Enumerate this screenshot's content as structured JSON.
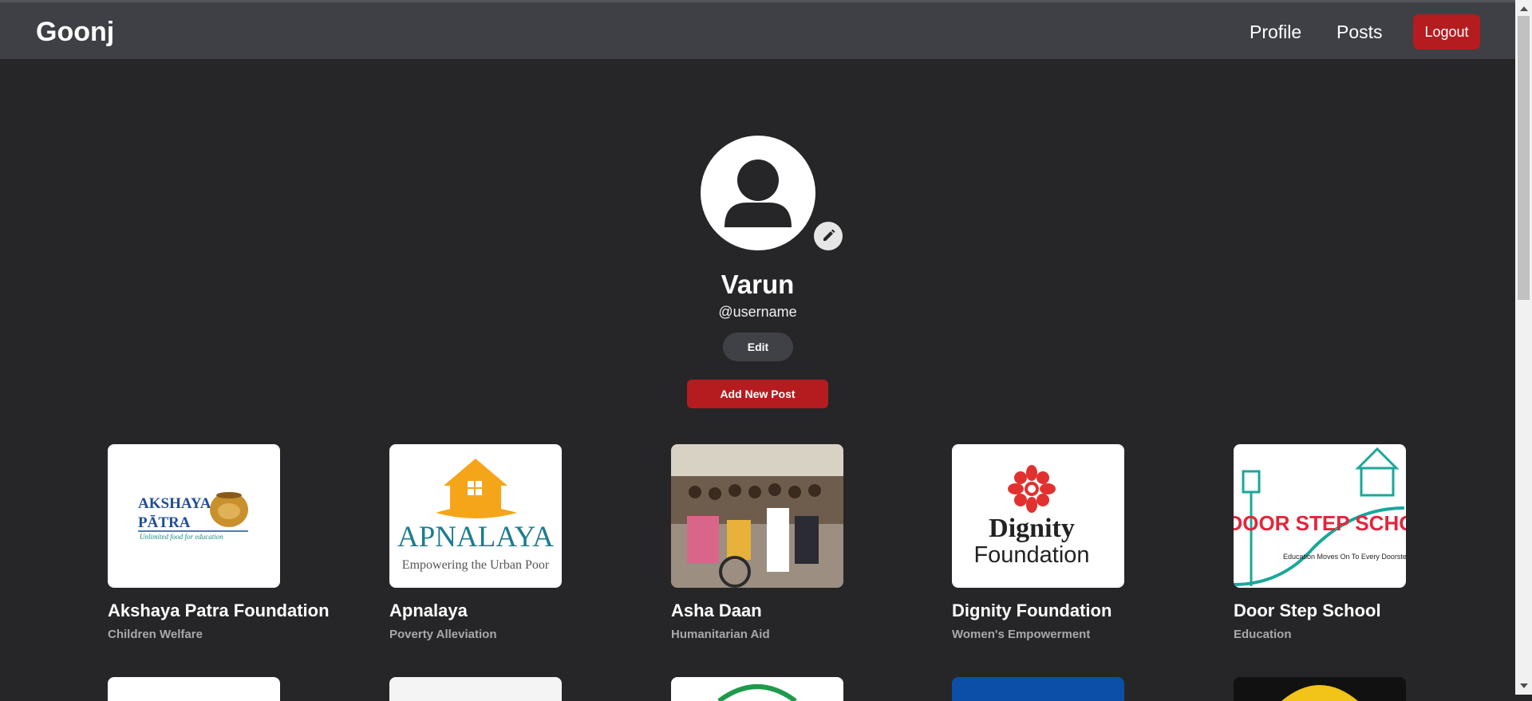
{
  "nav": {
    "brand": "Goonj",
    "profile": "Profile",
    "posts": "Posts",
    "logout": "Logout"
  },
  "profile": {
    "name": "Varun",
    "handle": "@username",
    "edit_label": "Edit",
    "add_post_label": "Add New Post"
  },
  "organizations": [
    {
      "name": "Akshaya Patra Foundation",
      "category": "Children Welfare",
      "logo_text": "AKSHAYA",
      "logo_text2": "PĀTRA",
      "logo_tagline": "Unlimited food for education"
    },
    {
      "name": "Apnalaya",
      "category": "Poverty Alleviation",
      "logo_text": "APNALAYA",
      "logo_tagline": "Empowering the Urban Poor"
    },
    {
      "name": "Asha Daan",
      "category": "Humanitarian Aid"
    },
    {
      "name": "Dignity Foundation",
      "category": "Women's Empowerment",
      "logo_text": "Dignity",
      "logo_text2": "Foundation"
    },
    {
      "name": "Door Step School",
      "category": "Education",
      "logo_text": "DOOR STEP SCHOOL",
      "logo_tagline": "Education Moves On To Every Doorstep"
    }
  ],
  "colors": {
    "accent": "#b51c20",
    "navbar": "#3f4045",
    "background": "#262628"
  }
}
